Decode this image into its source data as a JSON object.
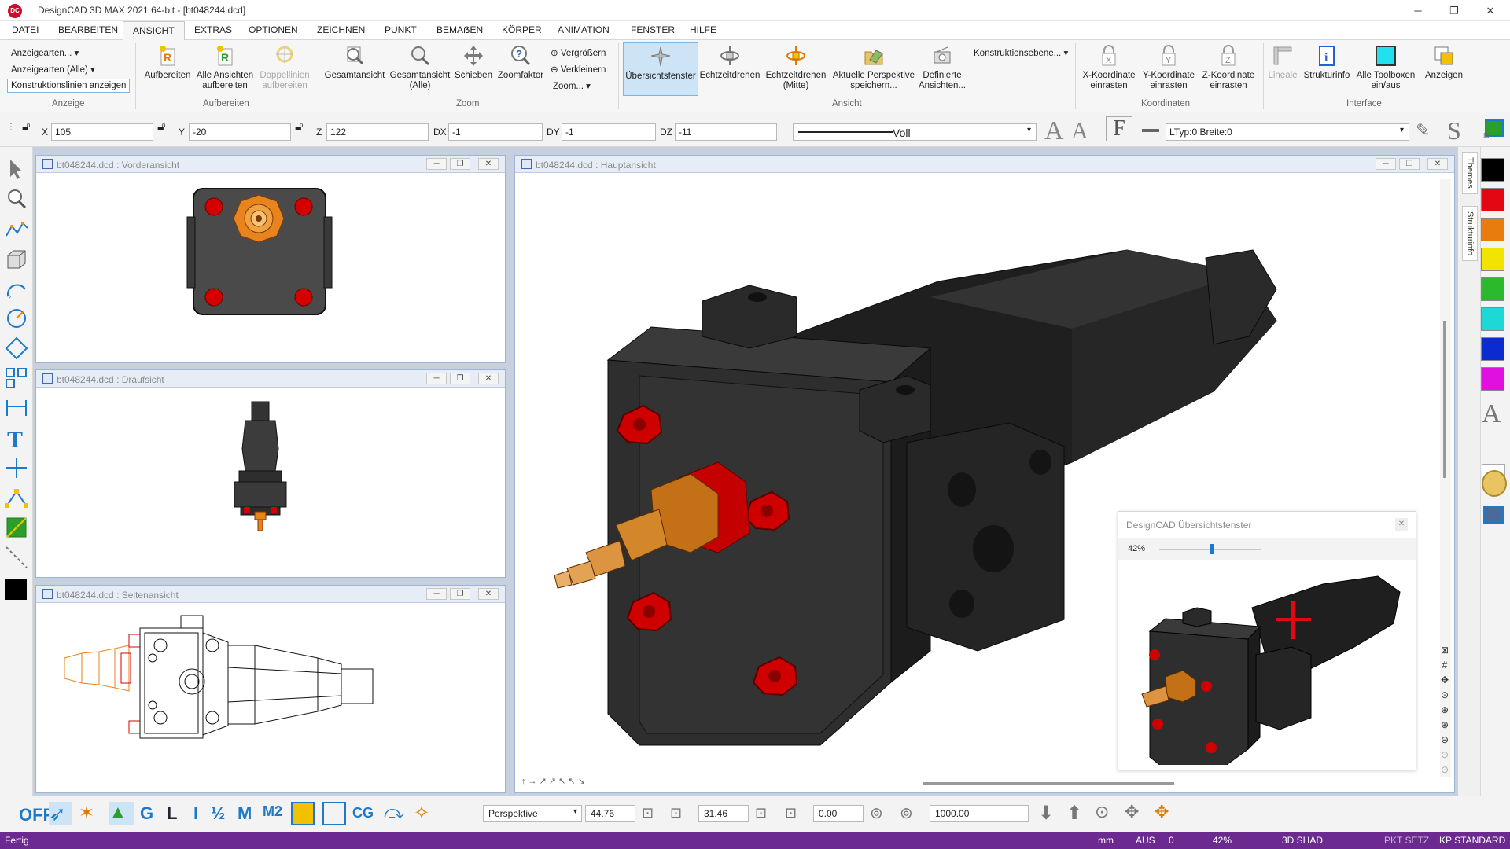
{
  "window": {
    "title": "DesignCAD 3D MAX 2021 64-bit - [bt048244.dcd]",
    "logo": "DC",
    "minimize": "─",
    "restore": "❐",
    "close": "✕"
  },
  "menu": [
    "DATEI",
    "BEARBEITEN",
    "ANSICHT",
    "EXTRAS",
    "OPTIONEN",
    "ZEICHNEN",
    "PUNKT",
    "BEMAẞEN",
    "KÖRPER",
    "ANIMATION",
    "FENSTER",
    "HILFE"
  ],
  "ribbon": {
    "anzeige": {
      "items": [
        "Anzeigearten...",
        "Anzeigearten (Alle)",
        "Konstruktionslinien anzeigen"
      ],
      "label": "Anzeige"
    },
    "aufbereiten": {
      "buttons": [
        "Aufbereiten",
        "Alle Ansichten aufbereiten",
        "Doppellinien aufbereiten"
      ],
      "label": "Aufbereiten"
    },
    "zoom": {
      "buttons": [
        "Gesamtansicht",
        "Gesamtansicht (Alle)",
        "Schieben",
        "Zoomfaktor"
      ],
      "small": [
        "Vergrößern",
        "Verkleinern",
        "Zoom..."
      ],
      "label": "Zoom"
    },
    "ansicht": {
      "buttons": [
        "Übersichtsfenster",
        "Echtzeitdrehen",
        "Echtzeitdrehen (Mitte)",
        "Aktuelle Perspektive speichern...",
        "Definierte Ansichten..."
      ],
      "label": "Ansicht"
    },
    "konstruktionsebene": "Konstruktionsebene...",
    "koordinaten": {
      "buttons": [
        "X-Koordinate einrasten",
        "Y-Koordinate einrasten",
        "Z-Koordinate einrasten"
      ],
      "label": "Koordinaten"
    },
    "interface": {
      "buttons": [
        "Lineale",
        "Strukturinfo",
        "Alle Toolboxen ein/aus",
        "Anzeigen"
      ],
      "label": "Interface"
    }
  },
  "coords": {
    "x_label": "X",
    "x": "105",
    "y_label": "Y",
    "y": "-20",
    "z_label": "Z",
    "z": "122",
    "dx_label": "DX",
    "dx": "-1",
    "dy_label": "DY",
    "dy": "-1",
    "dz_label": "DZ",
    "dz": "-11",
    "linestyle": "Voll",
    "linetype": "LTyp:0  Breite:0"
  },
  "windows": {
    "front": "bt048244.dcd : Vorderansicht",
    "top": "bt048244.dcd : Draufsicht",
    "side": "bt048244.dcd : Seitenansicht",
    "main": "bt048244.dcd : Hauptansicht"
  },
  "overview": {
    "title": "DesignCAD Übersichtsfenster",
    "zoom": "42%",
    "zoom_value": 0.42
  },
  "right_tabs": [
    "Themes",
    "Strukturinfo"
  ],
  "colors": {
    "swatches": [
      "#000000",
      "#e30613",
      "#e87d0d",
      "#f2e400",
      "#2db92d",
      "#1ed8d8",
      "#0a2bd0",
      "#e010e0"
    ],
    "accent": "#6c2a90",
    "part_red": "#d40000",
    "part_orange": "#d07a1c",
    "body": "#2b2b2b"
  },
  "bottom": {
    "off": "OFF",
    "projection": "Perspektive",
    "v1": "44.76",
    "v2": "31.46",
    "v3": "0.00",
    "v4": "1000.00"
  },
  "status": {
    "left": "Fertig",
    "unit": "mm",
    "aus": "AUS",
    "zero": "0",
    "zoom": "42%",
    "mode": "3D SHAD",
    "pkt": "PKT SETZ",
    "kp": "KP STANDARD"
  }
}
